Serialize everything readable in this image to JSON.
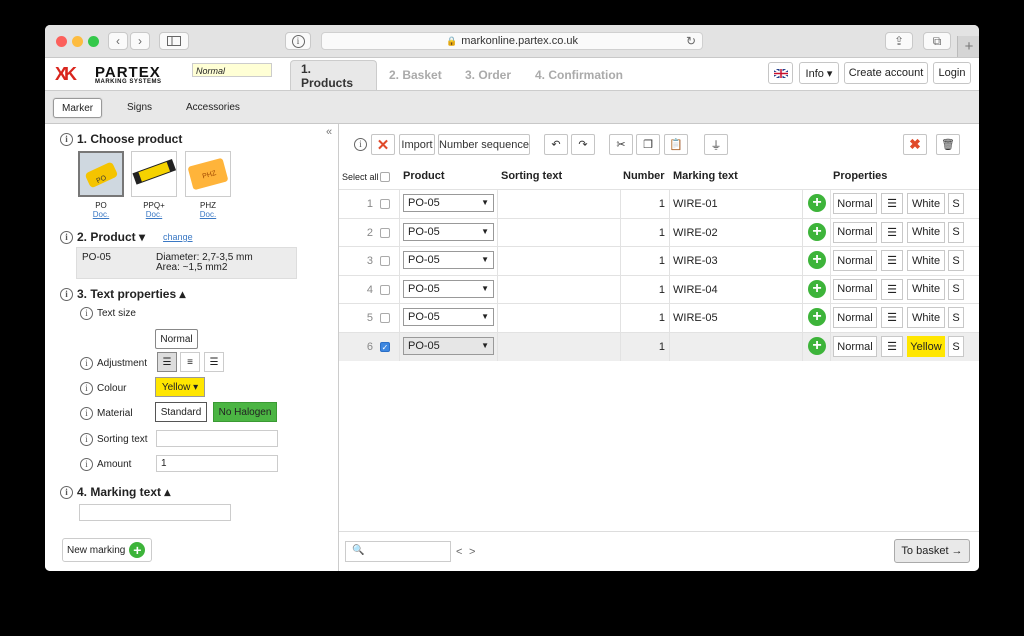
{
  "browser": {
    "url": "markonline.partex.co.uk"
  },
  "header": {
    "logo_mark": "XK",
    "logo_name": "PARTEX",
    "logo_sub": "MARKING SYSTEMS",
    "mode": "Normal",
    "steps": [
      "1. Products",
      "2. Basket",
      "3. Order",
      "4. Confirmation"
    ],
    "info_label": "Info ▾",
    "create_account": "Create account",
    "login": "Login"
  },
  "subnav": [
    "Marker",
    "Signs",
    "Accessories"
  ],
  "left": {
    "collapse": "«",
    "choose_title": "1. Choose product",
    "products": [
      {
        "name": "PO",
        "doc": "Doc."
      },
      {
        "name": "PPQ+",
        "doc": "Doc."
      },
      {
        "name": "PHZ",
        "doc": "Doc."
      }
    ],
    "product_title": "2. Product ▾",
    "change": "change",
    "product_code": "PO-05",
    "diameter": "Diameter: 2,7-3,5 mm",
    "area": "Area: ~1,5 mm2",
    "text_props_title": "3. Text properties ▴",
    "text_size_label": "Text size",
    "text_size_value": "Normal",
    "adjustment_label": "Adjustment",
    "colour_label": "Colour",
    "colour_value": "Yellow ▾",
    "material_label": "Material",
    "material_standard": "Standard",
    "material_nohalogen": "No Halogen",
    "sorting_label": "Sorting text",
    "sorting_value": "",
    "amount_label": "Amount",
    "amount_value": "1",
    "marking_title": "4. Marking text ▴",
    "marking_value": "",
    "new_marking": "New marking"
  },
  "toolbar": {
    "import": "Import",
    "number_sequence": "Number sequence"
  },
  "table": {
    "select_all": "Select all",
    "headers": [
      "Product",
      "Sorting text",
      "Number",
      "Marking text",
      "Properties"
    ],
    "rows": [
      {
        "idx": "1",
        "product": "PO-05",
        "sorting": "",
        "number": "1",
        "marking": "WIRE-01",
        "size": "Normal",
        "colour": "White",
        "s": "S",
        "checked": false
      },
      {
        "idx": "2",
        "product": "PO-05",
        "sorting": "",
        "number": "1",
        "marking": "WIRE-02",
        "size": "Normal",
        "colour": "White",
        "s": "S",
        "checked": false
      },
      {
        "idx": "3",
        "product": "PO-05",
        "sorting": "",
        "number": "1",
        "marking": "WIRE-03",
        "size": "Normal",
        "colour": "White",
        "s": "S",
        "checked": false
      },
      {
        "idx": "4",
        "product": "PO-05",
        "sorting": "",
        "number": "1",
        "marking": "WIRE-04",
        "size": "Normal",
        "colour": "White",
        "s": "S",
        "checked": false
      },
      {
        "idx": "5",
        "product": "PO-05",
        "sorting": "",
        "number": "1",
        "marking": "WIRE-05",
        "size": "Normal",
        "colour": "White",
        "s": "S",
        "checked": false
      },
      {
        "idx": "6",
        "product": "PO-05",
        "sorting": "",
        "number": "1",
        "marking": "",
        "size": "Normal",
        "colour": "Yellow",
        "s": "S",
        "checked": true
      }
    ]
  },
  "footer": {
    "search_placeholder": "",
    "to_basket": "To basket →"
  },
  "colors": {
    "accent_green": "#3db43a",
    "yellow": "#ffe600",
    "brand_red": "#d9251d"
  }
}
